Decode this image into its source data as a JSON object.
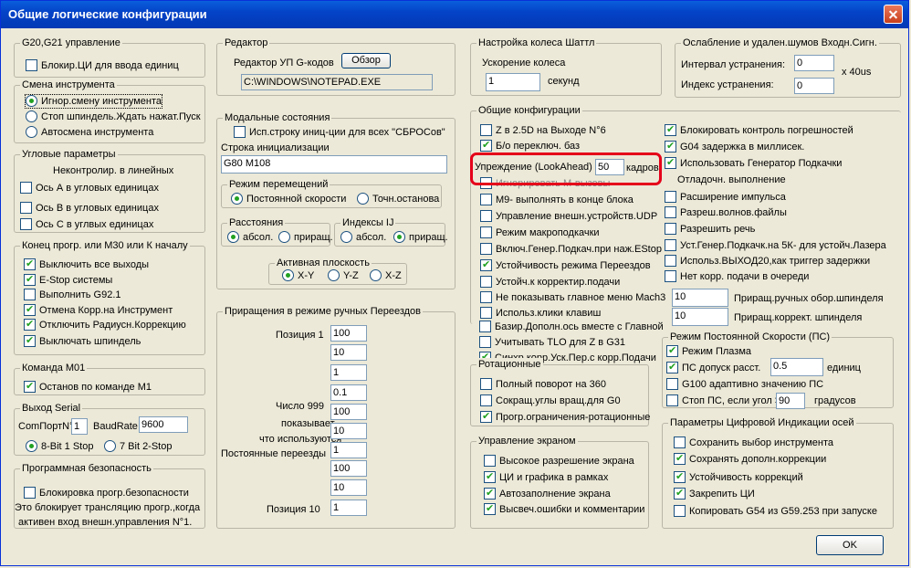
{
  "window": {
    "title": "Общие логические конфигурации"
  },
  "g20": {
    "title": "G20,G21 управление",
    "block_label": "Блокир.ЦИ для ввода единиц"
  },
  "tool": {
    "title": "Смена инструмента",
    "opt1": "Игнор.смену инструмента",
    "opt2": "Стоп шпиндель.Ждать нажат.Пуск",
    "opt3": "Автосмена инструмента"
  },
  "angular": {
    "title": "Угловые параметры",
    "note": "Неконтролир. в линейных",
    "a": "Ось А в угловых единицах",
    "b": "Ось В в угловых единицах",
    "c": "Ось С в углвых единицах"
  },
  "endprog": {
    "title": "Конец прогр. или M30 или К началу",
    "i1": "Выключить все выходы",
    "i2": "E-Stop системы",
    "i3": "Выполнить G92.1",
    "i4": "Отмена Корр.на Инструмент",
    "i5": "Отключить Радиусн.Коррекцию",
    "i6": "Выключать шпиндель"
  },
  "m01": {
    "title": "Команда М01",
    "label": "Останов по команде М1"
  },
  "serial": {
    "title": "Выход Serial",
    "port_label": "ComПортN°",
    "port": "1",
    "baud_label": "BaudRate",
    "baud": "9600",
    "opt1": "8-Bit 1 Stop",
    "opt2": "7 Bit 2-Stop"
  },
  "safety": {
    "title": "Программная безопасность",
    "label": "Блокировка прогр.безопасности",
    "note1": "Это блокирует трансляцию прогр.,когда",
    "note2": "активен вход внешн.управления N°1."
  },
  "editor": {
    "title": "Редактор",
    "label": "Редактор УП G-кодов",
    "browse": "Обзор",
    "path": "C:\\WINDOWS\\NOTEPAD.EXE"
  },
  "modal": {
    "title": "Модальные состояния",
    "use_init": "Исп.строку иниц-ции для всех \"СБРОСов\"",
    "init_label": "Строка инициализации",
    "init_value": "G80 M108",
    "motion_title": "Режим перемещений",
    "motion1": "Постоянной скорости",
    "motion2": "Точн.останова",
    "dist_title": "Расстояния",
    "dist1": "абсол.",
    "dist2": "приращ.",
    "ij_title": "Индексы IJ",
    "ij1": "абсол.",
    "ij2": "приращ.",
    "plane_title": "Активная плоскость",
    "plane1": "X-Y",
    "plane2": "Y-Z",
    "plane3": "X-Z"
  },
  "jog": {
    "title": "Приращения в режиме ручных Переездов",
    "pos1": "Позиция 1",
    "pos10": "Позиция 10",
    "note1": "Число 999",
    "note2": "показывает,",
    "note3": "что используются",
    "note4": "Постоянные переезды",
    "values": [
      "100",
      "10",
      "1",
      "0.1",
      "100",
      "10",
      "1",
      "100",
      "10",
      "1"
    ]
  },
  "wheel": {
    "title": "Настройка колеса Шаттл",
    "accel_label": "Ускорение колеса",
    "accel": "1",
    "unit": "секунд"
  },
  "noise": {
    "title": "Ослабление и удален.шумов Входн.Сигн.",
    "interval_label": "Интервал устранения:",
    "interval": "0",
    "unit": "x 40us",
    "index_label": "Индекс устранения:",
    "index": "0"
  },
  "general": {
    "title": "Общие конфигурации",
    "left": [
      "Z в 2.5D на Выходе N°6",
      "Б/о переключ. баз",
      "",
      "Игнорировать М-вызовы",
      "М9- выполнять в конце блока",
      "Управление внешн.устройств.UDP",
      "Режим макроподкачки",
      "Включ.Генер.Подкач.при наж.EStop",
      "Устойчивость режима Переездов",
      "Устойч.к корректир.подачи",
      "Не показывать главное меню Mach3",
      "Использ.клики клавиш",
      "Базир.Дополн.ось вместе с Главной",
      "Учитывать TLO для Z в G31",
      "Синхр.корр.Уск.Пер.с корр.Подачи"
    ],
    "lookahead_label": "Упреждение (LookAhead)",
    "lookahead": "50",
    "lookahead_unit": "кадров",
    "right": [
      "Блокировать контроль погрешностей",
      "G04 задержка в миллисек.",
      "Использовать Генератор Подкачки",
      "Отладочн. выполнение",
      "Расширение импульса",
      "Разреш.волнов.файлы",
      "Разрешить речь",
      "Уст.Генер.Подкачк.на 5К- для устойч.Лазера",
      "Использ.ВЫХОД20,как триггер задержки",
      "Нет корр. подачи в очереди"
    ],
    "spindle_rev_value": "10",
    "spindle_rev_label": "Приращ.ручных обор.шпинделя",
    "spindle_cor_value": "10",
    "spindle_cor_label": "Приращ.коррект. шпинделя"
  },
  "rotation": {
    "title": "Ротационные",
    "i1": "Полный поворот на 360",
    "i2": "Сокращ.углы вращ.для G0",
    "i3": "Прогр.ограничения-ротационные"
  },
  "screen": {
    "title": "Управление экраном",
    "i1": "Высокое разрешение экрана",
    "i2": "ЦИ и графика в рамках",
    "i3": "Автозаполнение экрана",
    "i4": "Высвеч.ошибки и комментарии"
  },
  "cv": {
    "title": "Режим Постоянной Скорости (ПС)",
    "plasma": "Режим Плазма",
    "dist_label": "ПС допуск расст.",
    "dist": "0.5",
    "dist_unit": "единиц",
    "g100": "G100 адаптивно значению ПС",
    "stop_label": "Стоп ПС, если угол >",
    "stop": "90",
    "stop_unit": "градусов"
  },
  "dro": {
    "title": "Параметры Цифровой Индикации осей",
    "i1": "Сохранить выбор инструмента",
    "i2": "Сохранять дополн.коррекции",
    "i3": "Устойчивость коррекций",
    "i4": "Закрепить ЦИ",
    "i5": "Копировать G54 из G59.253 при запуске"
  },
  "ok_label": "OK",
  "colors": {
    "highlight": "#e5001a",
    "title_bar": "#0443c8",
    "check": "#21a121"
  }
}
